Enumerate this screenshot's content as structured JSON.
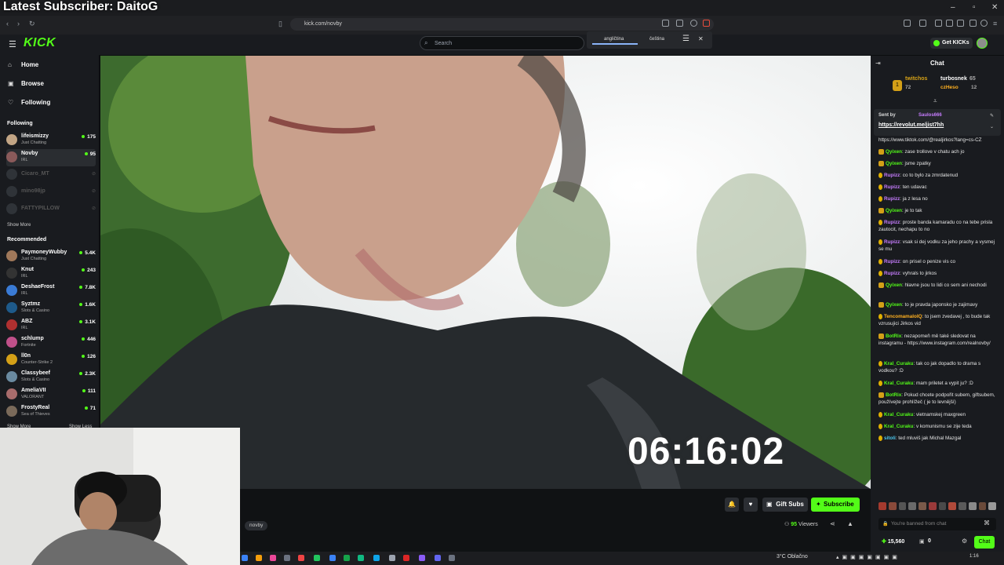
{
  "overlay": {
    "title": "Latest Subscriber: DaitoG"
  },
  "browser": {
    "url": "kick.com/novby",
    "window_controls": [
      "–",
      "▫",
      "✕"
    ]
  },
  "header": {
    "logo": "KICK",
    "search_placeholder": "Search",
    "translate_popup": {
      "tab_active": "angličtina",
      "tab_other": "čeština"
    },
    "get_kicks": "Get KICKs"
  },
  "sidebar": {
    "nav": [
      {
        "label": "Home",
        "icon": "home-icon"
      },
      {
        "label": "Browse",
        "icon": "browse-icon"
      },
      {
        "label": "Following",
        "icon": "heart-icon"
      }
    ],
    "following_heading": "Following",
    "following": [
      {
        "name": "lifeismizzy",
        "category": "Just Chatting",
        "viewers": "175",
        "live": true
      },
      {
        "name": "Novby",
        "category": "IRL",
        "viewers": "95",
        "live": true
      },
      {
        "name": "Cicaro_MT",
        "category": "",
        "viewers": "",
        "live": false
      },
      {
        "name": "mino98jp",
        "category": "",
        "viewers": "",
        "live": false
      },
      {
        "name": "FATTYPILLOW",
        "category": "",
        "viewers": "",
        "live": false
      }
    ],
    "show_more": "Show More",
    "recommended_heading": "Recommended",
    "recommended": [
      {
        "name": "PaymoneyWubby",
        "category": "Just Chatting",
        "viewers": "5.4K"
      },
      {
        "name": "Knut",
        "category": "IRL",
        "viewers": "243"
      },
      {
        "name": "DeshaeFrost",
        "category": "IRL",
        "viewers": "7.8K"
      },
      {
        "name": "Syztmz",
        "category": "Slots & Casino",
        "viewers": "1.6K"
      },
      {
        "name": "ABZ",
        "category": "IRL",
        "viewers": "3.1K"
      },
      {
        "name": "schlump",
        "category": "Fortnite",
        "viewers": "446"
      },
      {
        "name": "ll0n",
        "category": "Counter-Strike 2",
        "viewers": "126"
      },
      {
        "name": "Classybeef",
        "category": "Slots & Casino",
        "viewers": "2.3K"
      },
      {
        "name": "AmeliaVII",
        "category": "VALORANT",
        "viewers": "111"
      },
      {
        "name": "FrostyReal",
        "category": "Sea of Thieves",
        "viewers": "71"
      }
    ],
    "show_more_2": "Show More",
    "show_less": "Show Less"
  },
  "video": {
    "timer": "06:16:02"
  },
  "stream": {
    "tag": "novby",
    "gift_subs": "Gift Subs",
    "subscribe": "Subscribe",
    "viewers_count": "95",
    "viewers_label": "Viewers"
  },
  "chat": {
    "title": "Chat",
    "gifters": [
      {
        "name": "twitchos",
        "count": "72",
        "rank": "1"
      },
      {
        "name": "turbosnek",
        "count": "65"
      },
      {
        "name": "czHeso",
        "count": "12"
      }
    ],
    "pinned": {
      "sent_by": "Sent by",
      "user": "Saulos666",
      "link": "https://revolut.me/jist7hh"
    },
    "first_line": "https://www.tiktok.com/@realjirkos?lang=cs-CZ",
    "messages": [
      {
        "user": "Qyixen",
        "text": "zase trollove v chatu ach jo",
        "color": "#53fc18"
      },
      {
        "user": "Qyixen",
        "text": "jsme zpatky",
        "color": "#53fc18"
      },
      {
        "user": "Rupizz",
        "text": "co to bylo za zmrdatenud",
        "color": "#c77dff"
      },
      {
        "user": "Rupizz",
        "text": "ten udavac",
        "color": "#c77dff"
      },
      {
        "user": "Rupizz",
        "text": "ja z lesa no",
        "color": "#c77dff"
      },
      {
        "user": "Qyixen",
        "text": "je to tak",
        "color": "#53fc18"
      },
      {
        "user": "Rupizz",
        "text": "proste banda kamaradu co na tebe prisla zautocit, nechapu to no",
        "color": "#c77dff"
      },
      {
        "user": "Rupizz",
        "text": "vsak si dej vodku za jeho prachy a vysmej se mu",
        "color": "#c77dff"
      },
      {
        "user": "Rupizz",
        "text": "on prisel o penize vis co",
        "color": "#c77dff"
      },
      {
        "user": "Rupizz",
        "text": "vyhrals to jirkos",
        "color": "#c77dff"
      },
      {
        "user": "Qyixen",
        "text": "hlavne jsou to lidi co sem ani nechodi",
        "color": "#53fc18"
      },
      {
        "user": "Qyixen",
        "text": "to je pravda japonsko je zajimavy",
        "color": "#53fc18"
      },
      {
        "user": "TencomamaloIQ",
        "text": "to jsem zvedavej , to bude tak vzrusujici Jirkos vid",
        "color": "#ffb020"
      },
      {
        "user": "BotRix",
        "text": "nezapomeň mě také sledovat na instagramu - https://www.instagram.com/realnovby/",
        "color": "#53fc18"
      },
      {
        "user": "Kral_Curaku",
        "text": "tak co jak dopadlo to drama s vodkou? :D",
        "color": "#53fc18"
      },
      {
        "user": "Kral_Curaku",
        "text": "mam priletet a vypit ju? :D",
        "color": "#53fc18"
      },
      {
        "user": "BotRix",
        "text": "Pokud chcete podpořit subem, giftsubem, používejte prohlížeč ( je to levnější)",
        "color": "#53fc18"
      },
      {
        "user": "Kral_Curaku",
        "text": "vietnamskej maxgreen",
        "color": "#53fc18"
      },
      {
        "user": "Kral_Curaku",
        "text": "v komunismu se zije teda",
        "color": "#53fc18"
      },
      {
        "user": "sitoli",
        "text": "ted mluviš jak Michal Mazgal",
        "color": "#4cc9f0"
      }
    ],
    "input_placeholder": "You're banned from chat",
    "balance": "15,560",
    "zero": "0",
    "chat_button": "Chat"
  },
  "taskbar": {
    "weather": "3°C  Oblačno",
    "time": "1:16"
  }
}
